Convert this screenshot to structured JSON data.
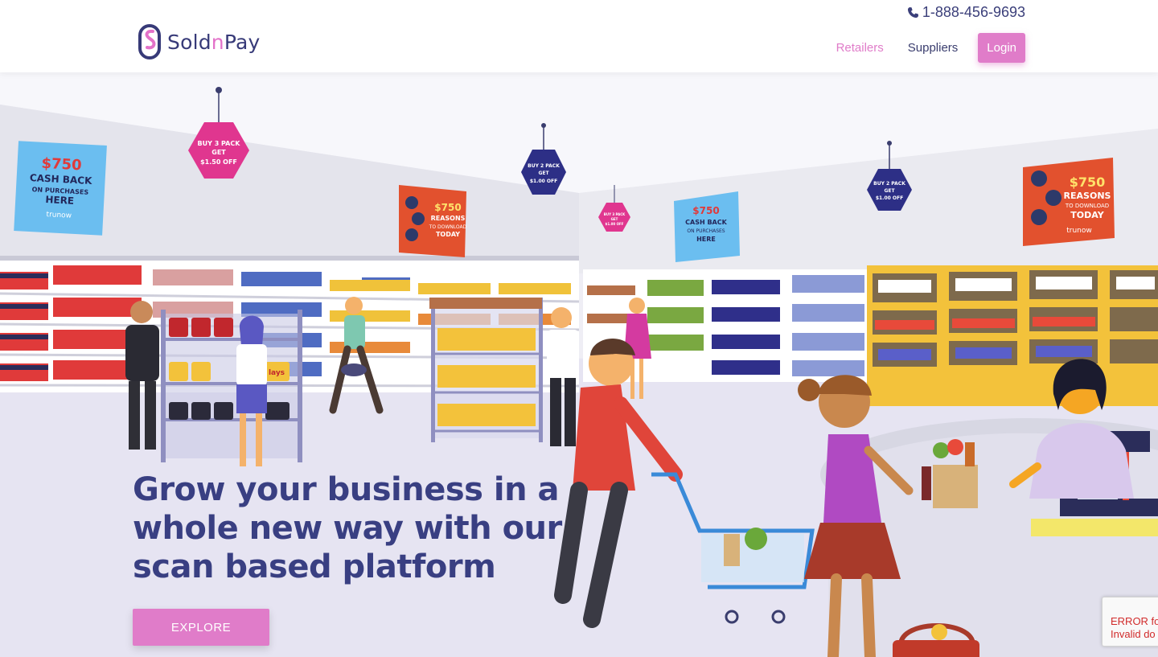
{
  "header": {
    "phone": "1-888-456-9693",
    "logo_text_start": "Sold",
    "logo_text_mid": "n",
    "logo_text_end": "Pay",
    "nav": {
      "retailers": "Retailers",
      "suppliers": "Suppliers",
      "login": "Login"
    }
  },
  "hero": {
    "headline": "Grow your business in a whole new way with our scan based platform",
    "explore_label": "EXPLORE",
    "signs": {
      "sign1_amount": "$750",
      "sign1_l1": "CASH BACK",
      "sign1_l2": "ON PURCHASES",
      "sign1_l3": "HERE",
      "hex1_l1": "BUY 3 PACK",
      "hex1_l2": "GET",
      "hex1_l3": "$1.50 OFF",
      "hex2_l1": "BUY 2 PACK",
      "hex2_l2": "GET",
      "hex2_l3": "$1.00 OFF",
      "sign2_amount": "$750",
      "sign2_l1": "REASONS",
      "sign2_l2": "TO DOWNLOAD",
      "sign2_l3": "TODAY",
      "brand": "trunow",
      "chip_lays": "lays"
    }
  },
  "recaptcha": {
    "line1": "ERROR fo",
    "line2": "Invalid do"
  },
  "colors": {
    "brand_navy": "#393f82",
    "brand_pink": "#e07cc9"
  }
}
